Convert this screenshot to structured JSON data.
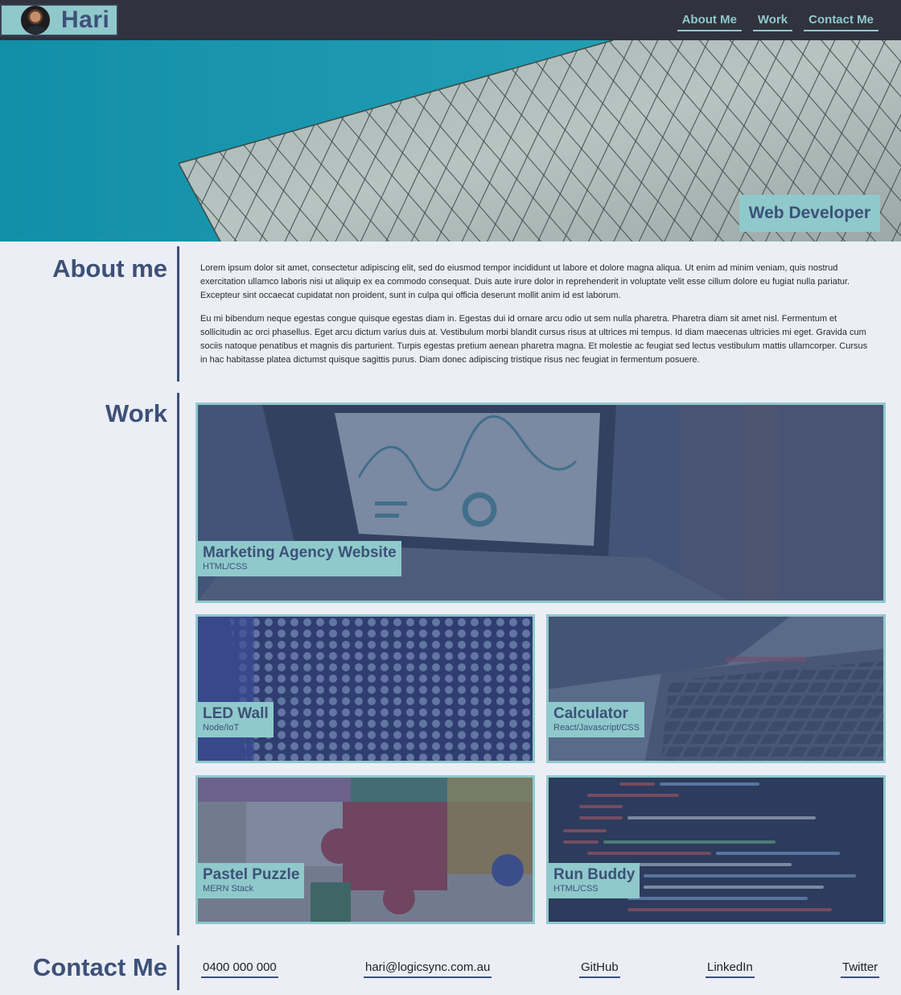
{
  "header": {
    "brand_name": "Hari",
    "nav": [
      {
        "label": "About Me"
      },
      {
        "label": "Work"
      },
      {
        "label": "Contact Me"
      }
    ]
  },
  "hero": {
    "badge": "Web Developer"
  },
  "about": {
    "title": "About me",
    "paragraphs": [
      "Lorem ipsum dolor sit amet, consectetur adipiscing elit, sed do eiusmod tempor incididunt ut labore et dolore magna aliqua. Ut enim ad minim veniam, quis nostrud exercitation ullamco laboris nisi ut aliquip ex ea commodo consequat. Duis aute irure dolor in reprehenderit in voluptate velit esse cillum dolore eu fugiat nulla pariatur. Excepteur sint occaecat cupidatat non proident, sunt in culpa qui officia deserunt mollit anim id est laborum.",
      "Eu mi bibendum neque egestas congue quisque egestas diam in. Egestas dui id ornare arcu odio ut sem nulla pharetra. Pharetra diam sit amet nisl. Fermentum et sollicitudin ac orci phasellus. Eget arcu dictum varius duis at. Vestibulum morbi blandit cursus risus at ultrices mi tempus. Id diam maecenas ultricies mi eget. Gravida cum sociis natoque penatibus et magnis dis parturient. Turpis egestas pretium aenean pharetra magna. Et molestie ac feugiat sed lectus vestibulum mattis ullamcorper. Cursus in hac habitasse platea dictumst quisque sagittis purus. Diam donec adipiscing tristique risus nec feugiat in fermentum posuere."
    ]
  },
  "work": {
    "title": "Work",
    "projects": [
      {
        "title": "Marketing Agency Website",
        "tech": "HTML/CSS"
      },
      {
        "title": "LED Wall",
        "tech": "Node/IoT"
      },
      {
        "title": "Calculator",
        "tech": "React/Javascript/CSS"
      },
      {
        "title": "Pastel Puzzle",
        "tech": "MERN Stack"
      },
      {
        "title": "Run Buddy",
        "tech": "HTML/CSS"
      }
    ]
  },
  "contact": {
    "title": "Contact Me",
    "links": [
      {
        "label": "0400 000 000"
      },
      {
        "label": "hari@logicsync.com.au"
      },
      {
        "label": "GitHub"
      },
      {
        "label": "LinkedIn"
      },
      {
        "label": "Twitter"
      }
    ]
  },
  "colors": {
    "navy": "#3d5178",
    "teal": "#8fc9cb",
    "header_bg": "#30323e",
    "page_bg": "#eceef6"
  }
}
